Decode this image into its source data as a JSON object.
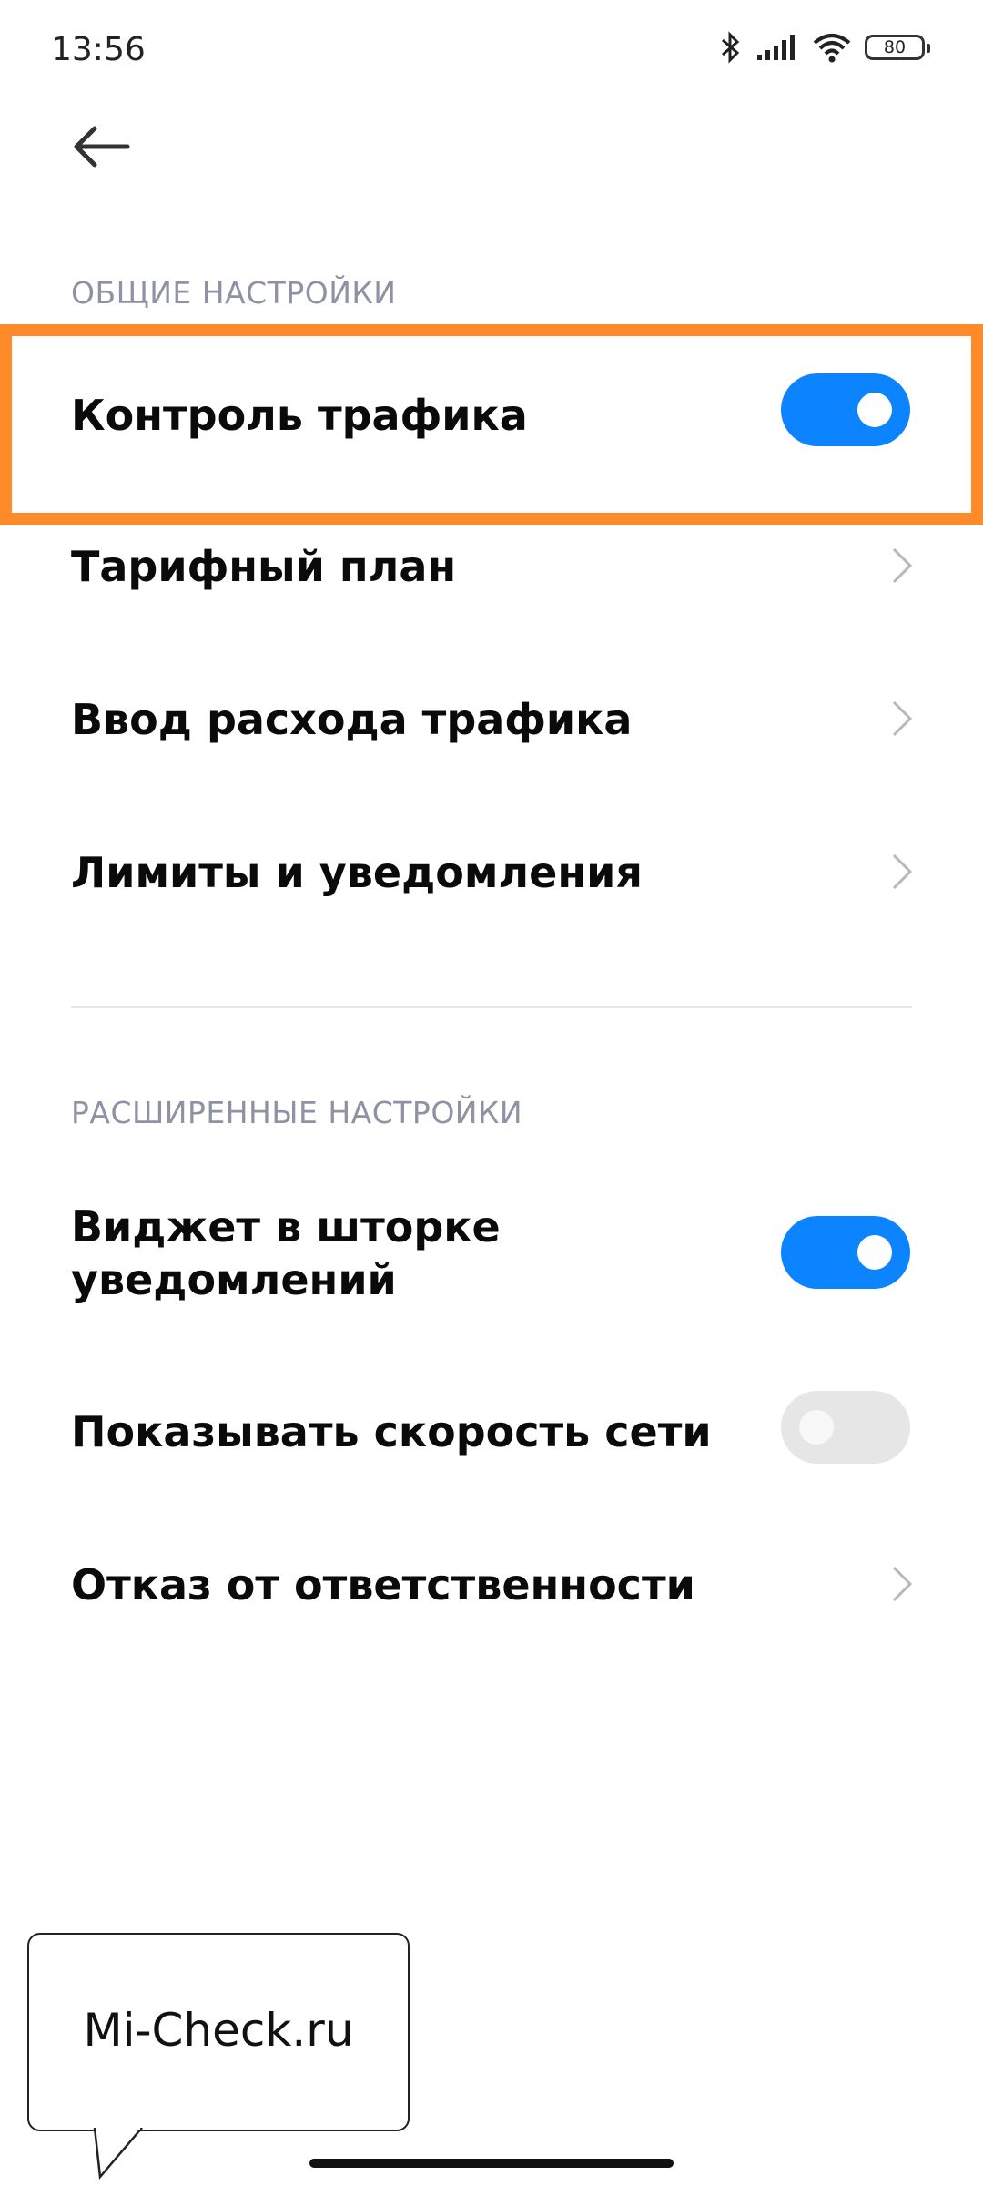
{
  "status_bar": {
    "time": "13:56",
    "battery": "80",
    "icons": [
      "bluetooth-icon",
      "signal-icon",
      "wifi-icon",
      "battery-icon"
    ]
  },
  "header": {
    "back_icon": "arrow-left-icon"
  },
  "sections": {
    "general": {
      "header": "ОБЩИЕ НАСТРОЙКИ",
      "items": [
        {
          "label": "Контроль трафика",
          "control": "toggle",
          "on": true
        },
        {
          "label": "Тарифный план",
          "control": "chevron"
        },
        {
          "label": "Ввод расхода трафика",
          "control": "chevron"
        },
        {
          "label": "Лимиты и уведомления",
          "control": "chevron"
        }
      ]
    },
    "advanced": {
      "header": "РАСШИРЕННЫЕ НАСТРОЙКИ",
      "items": [
        {
          "label_line1": "Виджет в шторке",
          "label_line2": "уведомлений",
          "control": "toggle",
          "on": true
        },
        {
          "label": "Показывать скорость сети",
          "control": "toggle",
          "on": false
        },
        {
          "label": "Отказ от ответственности",
          "control": "chevron"
        }
      ]
    }
  },
  "annotation": {
    "callout_text": "Mi-Check.ru",
    "highlight_color": "#ff8a2a"
  },
  "colors": {
    "accent": "#0d84ff",
    "toggle_off": "#e6e6e6",
    "section_header": "#8e92a4"
  }
}
